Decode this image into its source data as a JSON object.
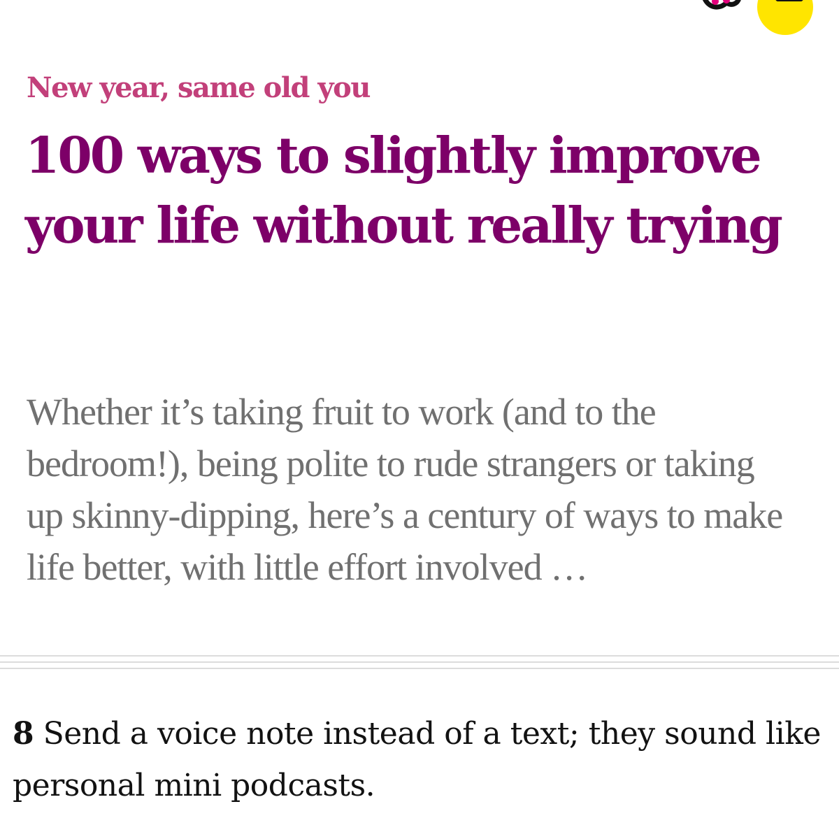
{
  "article": {
    "kicker": "New year, same old you",
    "headline": "100 ways to slightly improve your life without really trying",
    "standfirst": "Whether it’s taking fruit to work (and to the bedroom!), being polite to rude strangers or taking up skinny-dipping, here’s a century of ways to make life better, with little effort involved …",
    "item": {
      "number": "8",
      "text": "Send a voice note instead of a text; they sound like personal mini podcasts."
    }
  },
  "colors": {
    "kicker": "#c2407a",
    "headline": "#7d0068",
    "standfirst": "#707070",
    "body": "#121212",
    "icon_yellow": "#ffe500"
  },
  "icons": [
    "partial-icon",
    "account-icon"
  ]
}
